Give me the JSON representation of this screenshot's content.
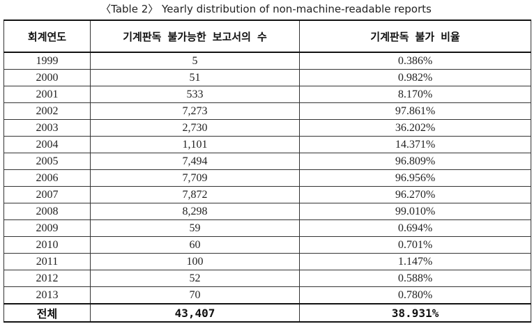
{
  "caption": "〈Table 2〉 Yearly distribution of non-machine-readable reports",
  "table": {
    "headers": [
      "회계연도",
      "기계판독 불가능한 보고서의 수",
      "기계판독 불가 비율"
    ],
    "rows": [
      [
        "1999",
        "5",
        "0.386%"
      ],
      [
        "2000",
        "51",
        "0.982%"
      ],
      [
        "2001",
        "533",
        "8.170%"
      ],
      [
        "2002",
        "7,273",
        "97.861%"
      ],
      [
        "2003",
        "2,730",
        "36.202%"
      ],
      [
        "2004",
        "1,101",
        "14.371%"
      ],
      [
        "2005",
        "7,494",
        "96.809%"
      ],
      [
        "2006",
        "7,709",
        "96.956%"
      ],
      [
        "2007",
        "7,872",
        "96.270%"
      ],
      [
        "2008",
        "8,298",
        "99.010%"
      ],
      [
        "2009",
        "59",
        "0.694%"
      ],
      [
        "2010",
        "60",
        "0.701%"
      ],
      [
        "2011",
        "100",
        "1.147%"
      ],
      [
        "2012",
        "52",
        "0.588%"
      ],
      [
        "2013",
        "70",
        "0.780%"
      ]
    ],
    "total": [
      "전체",
      "43,407",
      "38.931%"
    ]
  }
}
